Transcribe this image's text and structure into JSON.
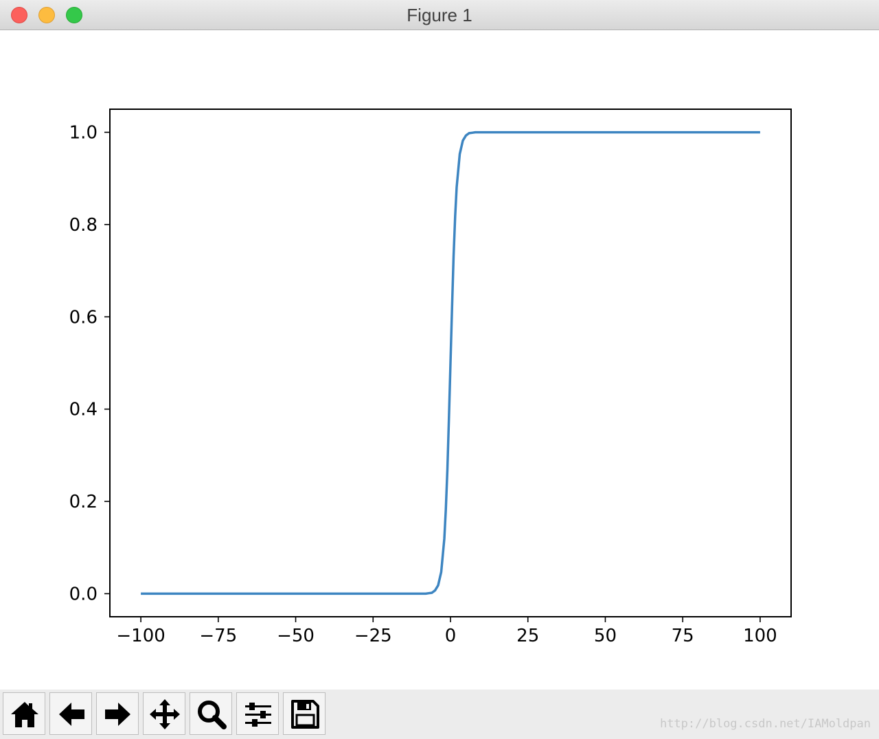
{
  "window": {
    "title": "Figure 1"
  },
  "toolbar": {
    "buttons": [
      {
        "name": "home-button",
        "icon": "home-icon"
      },
      {
        "name": "back-button",
        "icon": "arrow-left-icon"
      },
      {
        "name": "forward-button",
        "icon": "arrow-right-icon"
      },
      {
        "name": "pan-button",
        "icon": "move-icon"
      },
      {
        "name": "zoom-button",
        "icon": "magnifier-icon"
      },
      {
        "name": "subplots-button",
        "icon": "sliders-icon"
      },
      {
        "name": "save-button",
        "icon": "floppy-disk-icon"
      }
    ]
  },
  "watermark": "http://blog.csdn.net/IAMoldpan",
  "colors": {
    "line": "#3d85c1",
    "close": "#fc605c",
    "minimize": "#fdbc40",
    "maximize": "#34c84a"
  },
  "chart_data": {
    "type": "line",
    "title": "",
    "xlabel": "",
    "ylabel": "",
    "xlim": [
      -110,
      110
    ],
    "ylim": [
      -0.05,
      1.05
    ],
    "xticks": [
      -100,
      -75,
      -50,
      -25,
      0,
      25,
      50,
      75,
      100
    ],
    "xtick_labels": [
      "−100",
      "−75",
      "−50",
      "−25",
      "0",
      "25",
      "50",
      "75",
      "100"
    ],
    "yticks": [
      0.0,
      0.2,
      0.4,
      0.6,
      0.8,
      1.0
    ],
    "ytick_labels": [
      "0.0",
      "0.2",
      "0.4",
      "0.6",
      "0.8",
      "1.0"
    ],
    "grid": false,
    "series": [
      {
        "x": [
          -100,
          -80,
          -60,
          -40,
          -20,
          -10,
          -8,
          -7,
          -6,
          -5,
          -4,
          -3,
          -2,
          -1.5,
          -1,
          -0.5,
          0,
          0.5,
          1,
          1.5,
          2,
          3,
          4,
          5,
          6,
          7,
          8,
          10,
          20,
          40,
          60,
          80,
          100
        ],
        "y": [
          0.0,
          0.0,
          0.0,
          0.0,
          0.0,
          0.0,
          0.0,
          0.001,
          0.002,
          0.007,
          0.018,
          0.047,
          0.119,
          0.182,
          0.269,
          0.378,
          0.5,
          0.622,
          0.731,
          0.818,
          0.881,
          0.953,
          0.982,
          0.993,
          0.998,
          0.999,
          1.0,
          1.0,
          1.0,
          1.0,
          1.0,
          1.0,
          1.0
        ]
      }
    ]
  }
}
